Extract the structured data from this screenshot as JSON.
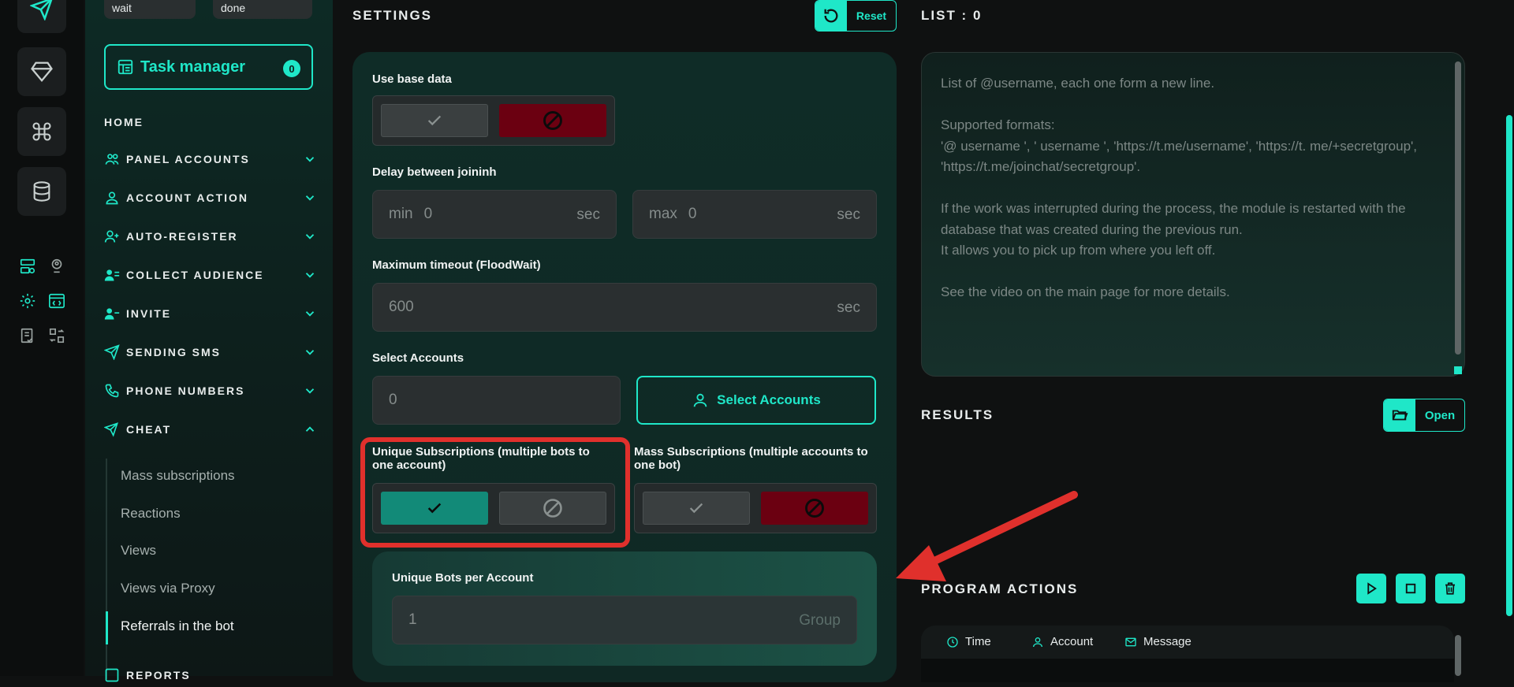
{
  "chips": {
    "wait": "wait",
    "done": "done"
  },
  "task_manager": {
    "label": "Task manager",
    "count": "0"
  },
  "nav": {
    "home": "HOME",
    "items": [
      {
        "label": "PANEL ACCOUNTS",
        "icon": "users-icon"
      },
      {
        "label": "ACCOUNT ACTION",
        "icon": "user-icon"
      },
      {
        "label": "AUTO-REGISTER",
        "icon": "user-plus-icon"
      },
      {
        "label": "COLLECT AUDIENCE",
        "icon": "users-list-icon"
      },
      {
        "label": "INVITE",
        "icon": "user-invite-icon"
      },
      {
        "label": "SENDING SMS",
        "icon": "send-icon"
      },
      {
        "label": "PHONE NUMBERS",
        "icon": "phone-icon"
      },
      {
        "label": "CHEAT",
        "icon": "send-sparkle-icon"
      }
    ],
    "cheat_sub": [
      "Mass subscriptions",
      "Reactions",
      "Views",
      "Views via Proxy",
      "Referrals in the bot"
    ],
    "reports": "REPORTS"
  },
  "settings": {
    "title": "SETTINGS",
    "reset": "Reset",
    "use_base_data": "Use base data",
    "delay_label": "Delay between joininh",
    "delay_min_prefix": "min",
    "delay_min_value": "0",
    "delay_max_prefix": "max",
    "delay_max_value": "0",
    "sec": "sec",
    "timeout_label": "Maximum timeout (FloodWait)",
    "timeout_value": "600",
    "select_accounts_label": "Select Accounts",
    "accounts_count": "0",
    "select_accounts_button": "Select Accounts",
    "unique_subs_label": "Unique Subscriptions (multiple bots to one account)",
    "mass_subs_label": "Mass Subscriptions (multiple accounts to one bot)",
    "unique_bots_label": "Unique Bots per Account",
    "unique_bots_value": "1",
    "unique_bots_suffix": "Group"
  },
  "list": {
    "title": "LIST : 0",
    "placeholder": "List of @username, each one form a new line.\n\nSupported formats:\n'@ username ', ' username ', 'https://t.me/username', 'https://t. me/+secretgroup', 'https://t.me/joinchat/secretgroup'.\n\nIf the work was interrupted during the process, the module is restarted with the database that was created during the previous run.\nIt allows you to pick up from where you left off.\n\nSee the video on the main page for more details."
  },
  "results": {
    "title": "RESULTS",
    "open": "Open"
  },
  "actions": {
    "title": "PROGRAM ACTIONS",
    "columns": [
      "Time",
      "Account",
      "Message"
    ]
  },
  "colors": {
    "accent": "#1fe7c8",
    "danger": "#6b0011",
    "annotation": "#e0302c"
  }
}
